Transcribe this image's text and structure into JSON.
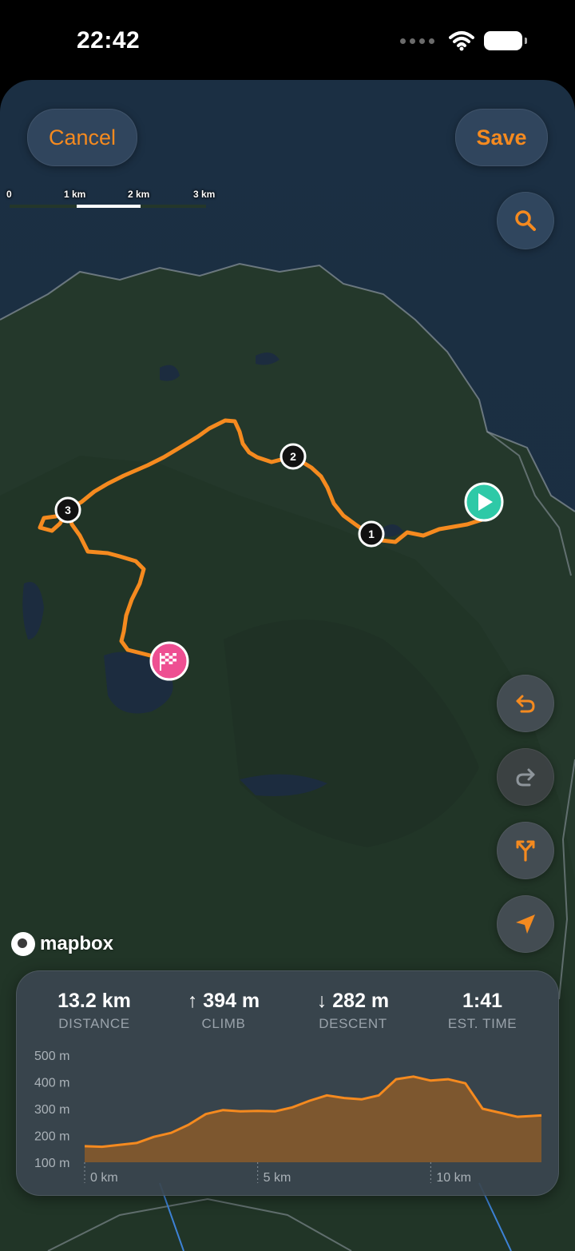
{
  "status_bar": {
    "time": "22:42"
  },
  "toolbar": {
    "cancel_label": "Cancel",
    "save_label": "Save"
  },
  "map": {
    "scale_labels": [
      "0",
      "1 km",
      "2 km",
      "3 km"
    ],
    "waypoints": [
      "1",
      "2",
      "3"
    ],
    "attribution": "mapbox",
    "colors": {
      "route": "#f58a1f",
      "start": "#2ec9a7",
      "finish": "#ee4f92"
    }
  },
  "stats": {
    "distance": {
      "value": "13.2 km",
      "label": "DISTANCE"
    },
    "climb": {
      "value": "↑ 394 m",
      "label": "CLIMB"
    },
    "descent": {
      "value": "↓ 282 m",
      "label": "DESCENT"
    },
    "time": {
      "value": "1:41",
      "label": "EST. TIME"
    }
  },
  "chart_data": {
    "type": "area",
    "y_ticks": [
      "500 m",
      "400 m",
      "300 m",
      "200 m",
      "100 m"
    ],
    "x_ticks": [
      "0 km",
      "5 km",
      "10 km"
    ],
    "ylim": [
      100,
      500
    ],
    "xlim": [
      0,
      13.2
    ],
    "series": [
      {
        "x": [
          0,
          0.5,
          1.0,
          1.5,
          2.0,
          2.5,
          3.0,
          3.5,
          4.0,
          4.5,
          5.0,
          5.5,
          6.0,
          6.5,
          7.0,
          7.5,
          8.0,
          8.5,
          9.0,
          9.5,
          10.0,
          10.5,
          11.0,
          11.5,
          12.0,
          12.5,
          13.2
        ],
        "y": [
          160,
          158,
          165,
          172,
          195,
          210,
          240,
          280,
          295,
          290,
          292,
          290,
          305,
          330,
          350,
          340,
          335,
          350,
          410,
          420,
          405,
          410,
          395,
          300,
          285,
          270,
          275
        ]
      }
    ]
  }
}
